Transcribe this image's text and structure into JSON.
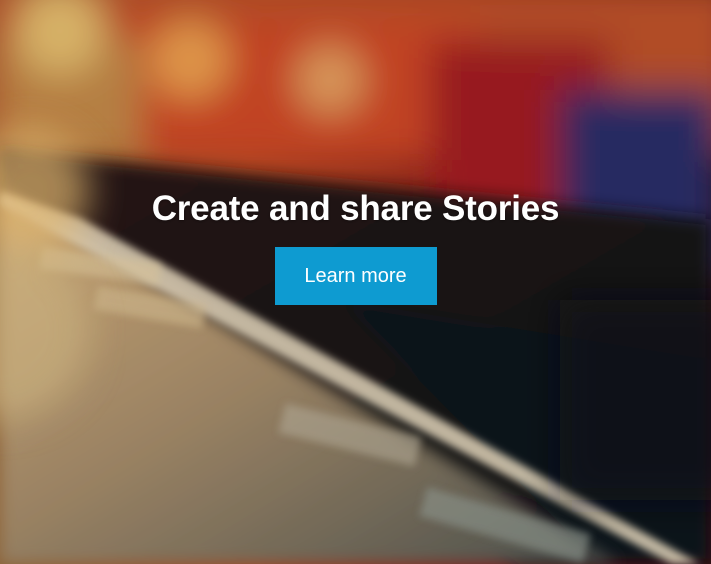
{
  "hero": {
    "title": "Create and share Stories",
    "button_label": "Learn more",
    "button_color": "#0e9bd1"
  },
  "background": {
    "description_icon": "blurred-train-platform-photo"
  }
}
